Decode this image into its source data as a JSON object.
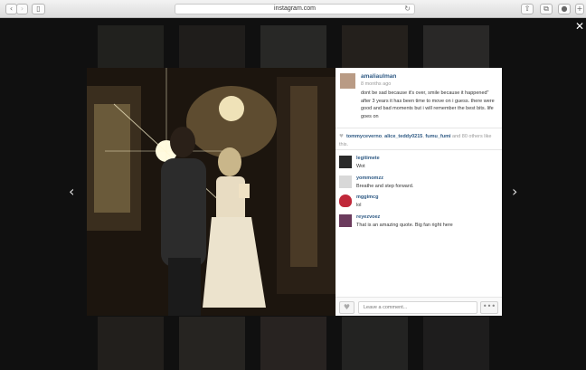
{
  "browser": {
    "address": "instagram.com",
    "back_icon": "‹",
    "forward_icon": "›",
    "sidebar_icon": "▯",
    "reload_icon": "↻",
    "share_icon": "⇧",
    "tabs_icon": "⧉",
    "download_icon": "●",
    "newtab_icon": "+"
  },
  "overlay": {
    "close_icon": "✕",
    "prev_icon": "‹",
    "next_icon": "›"
  },
  "post": {
    "owner": "amaliaulman",
    "time": "8 months ago",
    "caption": "dont be sad because it's over, smile because it happened\" after 3 years it has been time to move on i guess. there were good and bad moments but i will remember the best bits. life goes on",
    "likes": {
      "heart": "♥",
      "names": [
        "tommyceverno",
        "alice_teddy0215",
        "fumu_fumi"
      ],
      "suffix_and": " and ",
      "count": "80",
      "suffix_text": " others like this."
    },
    "comments": [
      {
        "user": "legitimete",
        "text": "Wot",
        "avatar_color": "#2a2a2a"
      },
      {
        "user": "yommomzz",
        "text": "Breathe and step forward.",
        "avatar_color": "#d8d8d8"
      },
      {
        "user": "mggimcg",
        "text": "lol",
        "avatar_color": "#c0283a"
      },
      {
        "user": "reyezvoez",
        "text": "That is an amazing quote. Big fan right here",
        "avatar_color": "#6b3b5d"
      }
    ],
    "comment_placeholder": "Leave a comment...",
    "like_button_icon": "♥",
    "more_button": "•••"
  }
}
